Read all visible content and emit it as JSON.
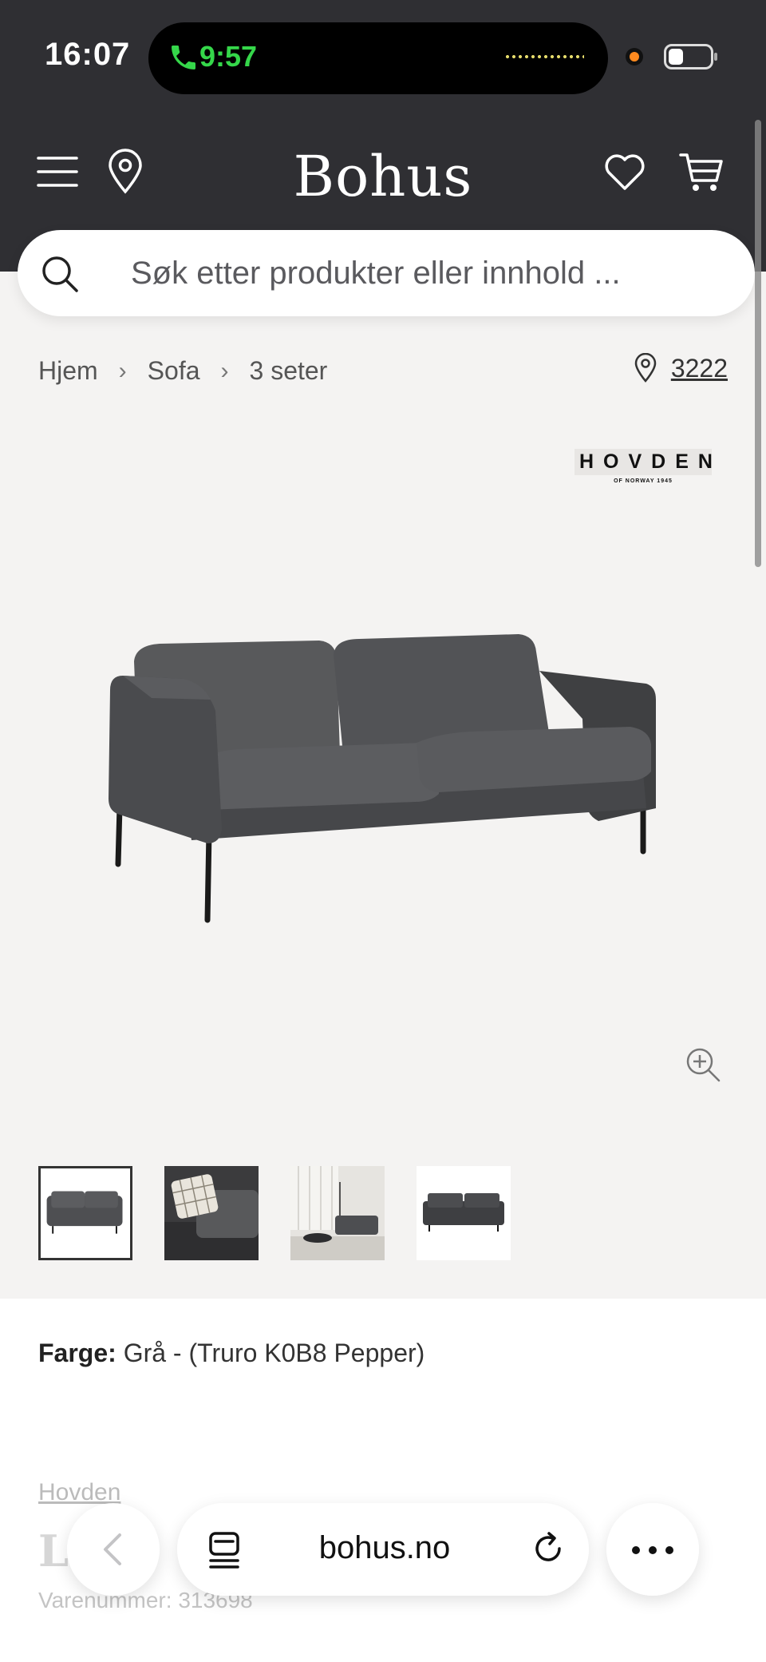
{
  "status_bar": {
    "time": "16:07",
    "call_time": "9:57"
  },
  "header": {
    "brand": "Bohus",
    "search_placeholder": "Søk etter produkter eller innhold ..."
  },
  "breadcrumb": {
    "items": [
      "Hjem",
      "Sofa",
      "3 seter"
    ],
    "store_number": "3222"
  },
  "product": {
    "brand_logo": "HOVDEN",
    "brand_logo_sub": "OF NORWAY 1945",
    "color_label": "Farge:",
    "color_value": "Grå - (Truro K0B8 Pepper)",
    "brand_link": "Hovden",
    "title_partial": "L",
    "sku": "Varenummer: 313698",
    "thumbnail_count": 4
  },
  "browser": {
    "url": "bohus.no"
  },
  "colors": {
    "header_bg": "#2f2f33",
    "page_bg": "#f4f3f2",
    "call_green": "#35d74a"
  }
}
